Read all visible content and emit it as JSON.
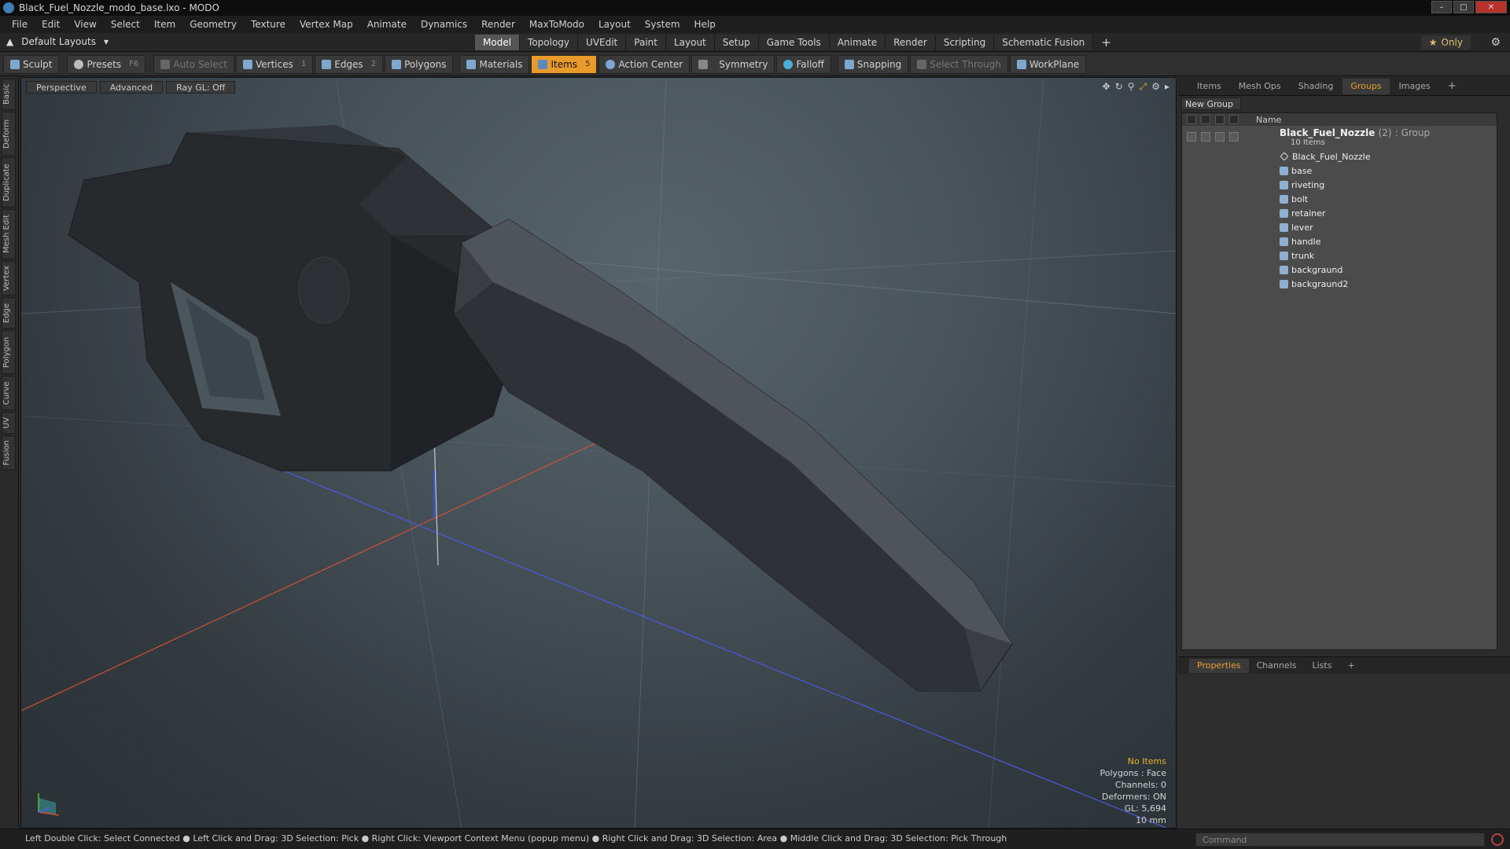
{
  "window": {
    "title": "Black_Fuel_Nozzle_modo_base.lxo - MODO"
  },
  "menu": [
    "File",
    "Edit",
    "View",
    "Select",
    "Item",
    "Geometry",
    "Texture",
    "Vertex Map",
    "Animate",
    "Dynamics",
    "Render",
    "MaxToModo",
    "Layout",
    "System",
    "Help"
  ],
  "layout": {
    "selector": "Default Layouts",
    "tabs": [
      "Model",
      "Topology",
      "UVEdit",
      "Paint",
      "Layout",
      "Setup",
      "Game Tools",
      "Animate",
      "Render",
      "Scripting",
      "Schematic Fusion"
    ],
    "active_tab": "Model",
    "only_label": "Only"
  },
  "toolbar": {
    "sculpt": "Sculpt",
    "presets": "Presets",
    "presets_key": "F6",
    "auto_select": "Auto Select",
    "vertices": "Vertices",
    "vertices_key": "1",
    "edges": "Edges",
    "edges_key": "2",
    "polygons": "Polygons",
    "materials": "Materials",
    "items": "Items",
    "items_key": "5",
    "action_center": "Action Center",
    "symmetry": "Symmetry",
    "falloff": "Falloff",
    "snapping": "Snapping",
    "select_through": "Select Through",
    "workplane": "WorkPlane"
  },
  "left_tabs": [
    "Basic",
    "Deform",
    "Duplicate",
    "Mesh Edit",
    "Vertex",
    "Edge",
    "Polygon",
    "Curve",
    "UV",
    "Fusion"
  ],
  "viewport": {
    "view": "Perspective",
    "shading": "Advanced",
    "raygl": "Ray GL: Off",
    "info": {
      "selection": "No Items",
      "mode": "Polygons : Face",
      "channels": "Channels: 0",
      "deformers": "Deformers: ON",
      "gl": "GL: 5,694",
      "grid": "10 mm"
    }
  },
  "right_panel": {
    "tabs": [
      "Items",
      "Mesh Ops",
      "Shading",
      "Groups",
      "Images"
    ],
    "active_tab": "Groups",
    "new_group": "New Group",
    "col_name": "Name",
    "group": {
      "name": "Black_Fuel_Nozzle",
      "count": "(2)",
      "type": ": Group",
      "sub": "10 Items"
    },
    "items": [
      {
        "name": "Black_Fuel_Nozzle",
        "kind": "locator"
      },
      {
        "name": "base",
        "kind": "mesh"
      },
      {
        "name": "riveting",
        "kind": "mesh"
      },
      {
        "name": "bolt",
        "kind": "mesh"
      },
      {
        "name": "retainer",
        "kind": "mesh"
      },
      {
        "name": "lever",
        "kind": "mesh"
      },
      {
        "name": "handle",
        "kind": "mesh"
      },
      {
        "name": "trunk",
        "kind": "mesh"
      },
      {
        "name": "backgraund",
        "kind": "mesh"
      },
      {
        "name": "backgraund2",
        "kind": "mesh"
      }
    ],
    "props_tabs": [
      "Properties",
      "Channels",
      "Lists"
    ],
    "props_active": "Properties"
  },
  "status": {
    "hint": "Left Double Click: Select Connected ● Left Click and Drag: 3D Selection: Pick ● Right Click: Viewport Context Menu (popup menu) ● Right Click and Drag: 3D Selection: Area ● Middle Click and Drag: 3D Selection: Pick Through",
    "command_placeholder": "Command"
  },
  "colors": {
    "accent": "#e89a2a",
    "axis_x": "#d0503a",
    "axis_z": "#3a50d0"
  }
}
